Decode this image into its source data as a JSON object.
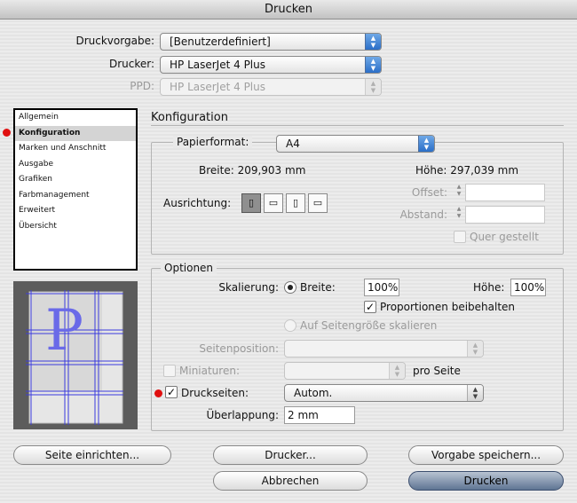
{
  "window": {
    "title": "Drucken"
  },
  "top": {
    "preset_label": "Druckvorgabe:",
    "preset_value": "[Benutzerdefiniert]",
    "printer_label": "Drucker:",
    "printer_value": "HP LaserJet 4 Plus",
    "ppd_label": "PPD:",
    "ppd_value": "HP LaserJet 4 Plus"
  },
  "sidebar": {
    "items": [
      {
        "label": "Allgemein"
      },
      {
        "label": "Konfiguration"
      },
      {
        "label": "Marken und Anschnitt"
      },
      {
        "label": "Ausgabe"
      },
      {
        "label": "Grafiken"
      },
      {
        "label": "Farbmanagement"
      },
      {
        "label": "Erweitert"
      },
      {
        "label": "Übersicht"
      }
    ]
  },
  "preview": {
    "letter": "P"
  },
  "config": {
    "title": "Konfiguration",
    "paper_label": "Papierformat:",
    "paper_value": "A4",
    "width_text": "Breite:  209,903 mm",
    "height_text": "Höhe:  297,039 mm",
    "orientation_label": "Ausrichtung:",
    "offset_label": "Offset:",
    "gap_label": "Abstand:",
    "transverse_label": "Quer gestellt"
  },
  "options": {
    "title": "Optionen",
    "scaling_label": "Skalierung:",
    "width_label": "Breite:",
    "width_value": "100%",
    "height_label": "Höhe:",
    "height_value": "100%",
    "keep_prop_label": "Proportionen beibehalten",
    "fit_label": "Auf Seitengröße skalieren",
    "position_label": "Seitenposition:",
    "position_value": "",
    "thumbs_label": "Miniaturen:",
    "thumbs_value": "",
    "per_page_label": "pro Seite",
    "tile_label": "Druckseiten:",
    "tile_value": "Autom.",
    "overlap_label": "Überlappung:",
    "overlap_value": "2 mm"
  },
  "buttons": {
    "page_setup": "Seite einrichten...",
    "printer": "Drucker...",
    "save_preset": "Vorgabe speichern...",
    "cancel": "Abbrechen",
    "print": "Drucken"
  },
  "colors": {
    "marker_dot": "#e01010",
    "default_button": "#5f7593"
  }
}
